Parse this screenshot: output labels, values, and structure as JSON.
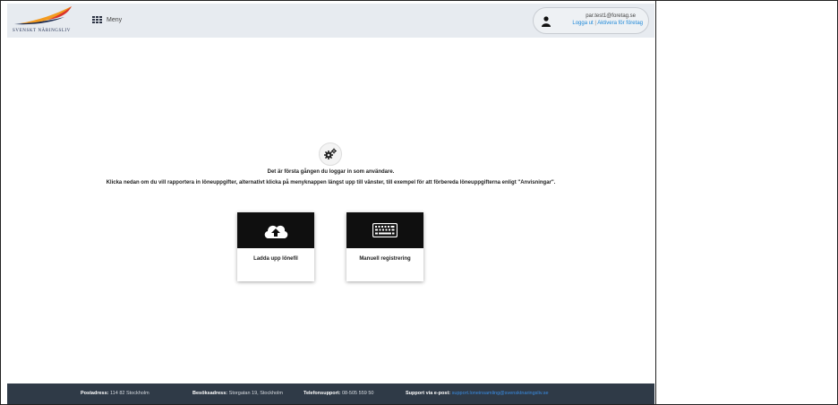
{
  "header": {
    "logo_text": "SVENSKT NÄRINGSLIV",
    "menu_label": "Meny",
    "user": {
      "email": "par.test1@foretag.se",
      "logout": "Logga ut",
      "separator": "|",
      "activate": "Aktivera för företag"
    }
  },
  "main": {
    "icon": "gears-icon",
    "message_line1": "Det är första gången du loggar in som användare.",
    "message_line2": "Klicka nedan om du vill rapportera in löneuppgifter, alternativt klicka på menyknappen längst upp till vänster, till exempel för att förbereda löneuppgifterna enligt \"Anvisningar\".",
    "cards": [
      {
        "icon": "cloud-upload-icon",
        "label": "Ladda upp lönefil"
      },
      {
        "icon": "keyboard-icon",
        "label": "Manuell registrering"
      }
    ]
  },
  "footer": {
    "postal_label": "Postadress:",
    "postal_value": "114 82 Stockholm",
    "visit_label": "Besöksadress:",
    "visit_value": "Storgatan 19, Stockholm",
    "phone_label": "Telefonsupport:",
    "phone_value": "08-505 559 50",
    "email_label": "Support via e-post:",
    "email_value": "support.loneinsamling@svensktnaringsliv.se"
  },
  "colors": {
    "header_bg": "#e7ebf0",
    "footer_bg": "#2f3a47",
    "link": "#1e88d8",
    "card_top": "#0f0f0f",
    "logo_orange": "#f39a1e",
    "logo_red": "#d9342b",
    "logo_navy": "#1b2a4e"
  }
}
